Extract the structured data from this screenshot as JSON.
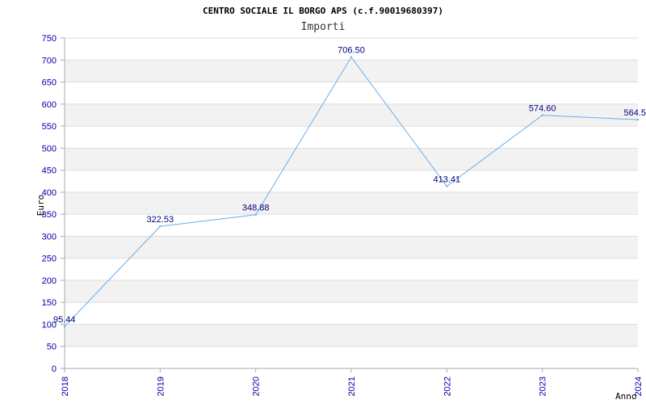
{
  "chart_data": {
    "type": "line",
    "title": "CENTRO SOCIALE IL BORGO APS (c.f.90019680397)",
    "subtitle": "Importi",
    "xlabel": "Anno",
    "ylabel": "Euro",
    "categories": [
      "2018",
      "2019",
      "2020",
      "2021",
      "2022",
      "2023",
      "2024"
    ],
    "series": [
      {
        "values": [
          95.44,
          322.53,
          348.88,
          706.5,
          413.41,
          574.6,
          564.5
        ],
        "labels": [
          "95.44",
          "322.53",
          "348.88",
          "706.50",
          "413.41",
          "574.60",
          "564.5"
        ]
      }
    ],
    "ylim": [
      0,
      750
    ],
    "yticks": [
      0,
      50,
      100,
      150,
      200,
      250,
      300,
      350,
      400,
      450,
      500,
      550,
      600,
      650,
      700,
      750
    ],
    "grid": true,
    "colors": {
      "line": "#6aaee8",
      "band_alt": "#f2f2f2",
      "grid": "#dddddd",
      "axis": "#aaaaaa",
      "tick_text": "#0000aa",
      "label_text": "#000080"
    }
  }
}
